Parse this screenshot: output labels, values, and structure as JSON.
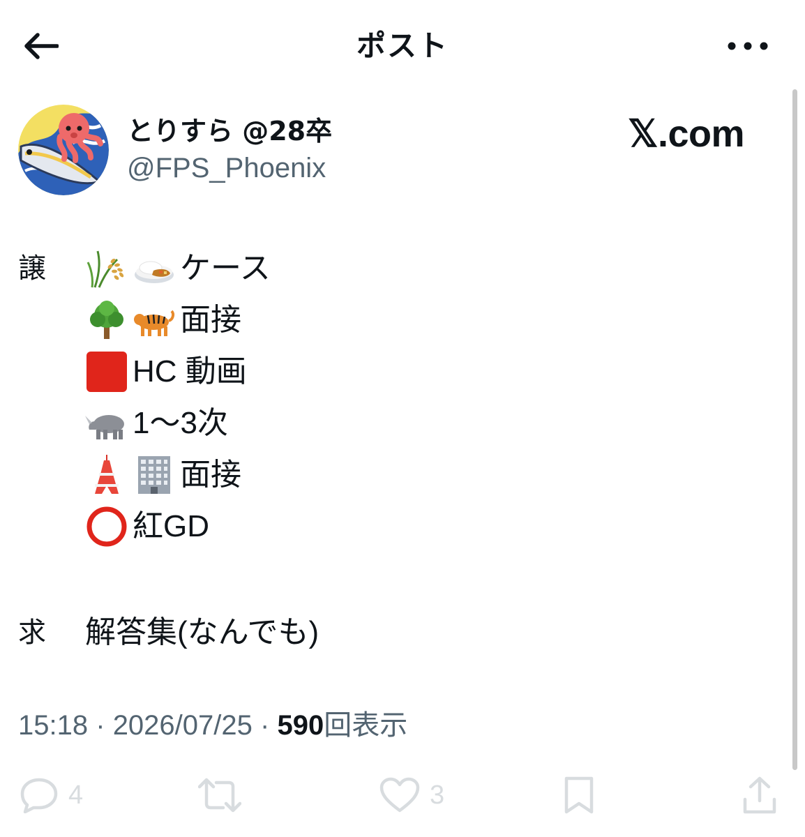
{
  "header": {
    "title": "ポスト",
    "back_icon": "arrow-left-icon",
    "more_icon": "more-dots-icon"
  },
  "author": {
    "display_name": "とりすら @28卒",
    "handle": "@FPS_Phoenix",
    "avatar_icon": "octopus-fish-avatar"
  },
  "brand": {
    "label": "𝕏.com"
  },
  "post": {
    "give_label": "譲",
    "give_items": [
      {
        "icons": [
          "rice-plant-icon",
          "curry-rice-icon"
        ],
        "text": "ケース"
      },
      {
        "icons": [
          "tree-icon",
          "tiger-icon"
        ],
        "text": "面接"
      },
      {
        "icons": [
          "red-square-icon"
        ],
        "text": "HC 動画"
      },
      {
        "icons": [
          "rhino-icon"
        ],
        "text": "1〜3次"
      },
      {
        "icons": [
          "tokyo-tower-icon",
          "office-building-icon"
        ],
        "text": "面接"
      },
      {
        "icons": [
          "red-circle-icon"
        ],
        "text": "紅GD"
      }
    ],
    "want_label": "求",
    "want_text": "解答集(なんでも)"
  },
  "meta": {
    "time": "15:18",
    "separator": "·",
    "date": "2026/07/25",
    "views_count": "590",
    "views_label": "回表示"
  },
  "actions": {
    "reply_count": "4",
    "repost_count": "",
    "like_count": "3"
  },
  "colors": {
    "text": "#0f1419",
    "secondary": "#536471",
    "scrollbar": "#c8c8c8",
    "background": "#ffffff"
  }
}
